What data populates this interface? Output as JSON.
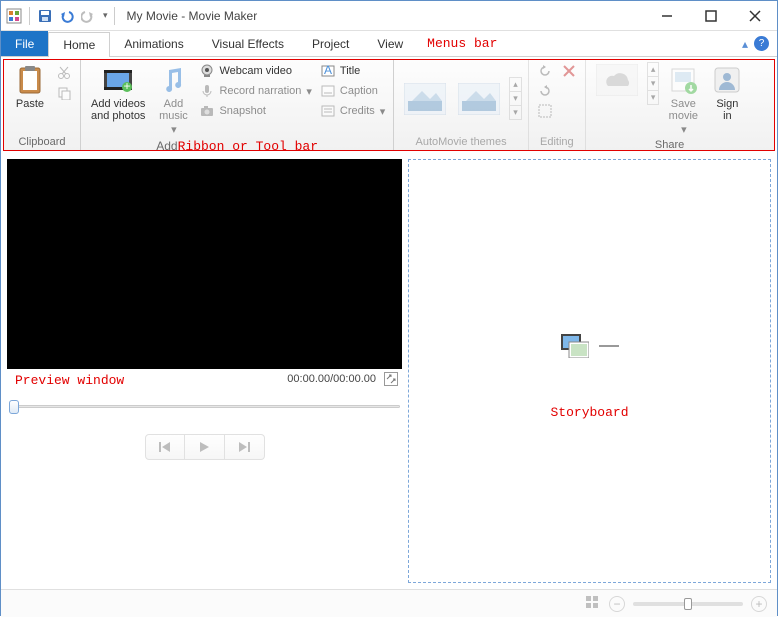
{
  "title": "My Movie - Movie Maker",
  "menus": {
    "file": "File",
    "home": "Home",
    "animations": "Animations",
    "visual_effects": "Visual Effects",
    "project": "Project",
    "view": "View"
  },
  "annotations": {
    "menus": "Menus bar",
    "ribbon": "Ribbon or Tool bar",
    "preview": "Preview window",
    "storyboard": "Storyboard"
  },
  "ribbon": {
    "clipboard": {
      "paste": "Paste",
      "label": "Clipboard"
    },
    "add": {
      "add_videos": "Add videos\nand photos",
      "add_music": "Add\nmusic",
      "webcam": "Webcam video",
      "record": "Record narration",
      "snapshot": "Snapshot",
      "title": "Title",
      "caption": "Caption",
      "credits": "Credits",
      "label": "Add"
    },
    "automovie": {
      "label": "AutoMovie themes"
    },
    "editing": {
      "label": "Editing"
    },
    "share": {
      "save": "Save\nmovie",
      "signin": "Sign\nin",
      "label": "Share"
    }
  },
  "preview": {
    "time": "00:00.00/00:00.00"
  }
}
